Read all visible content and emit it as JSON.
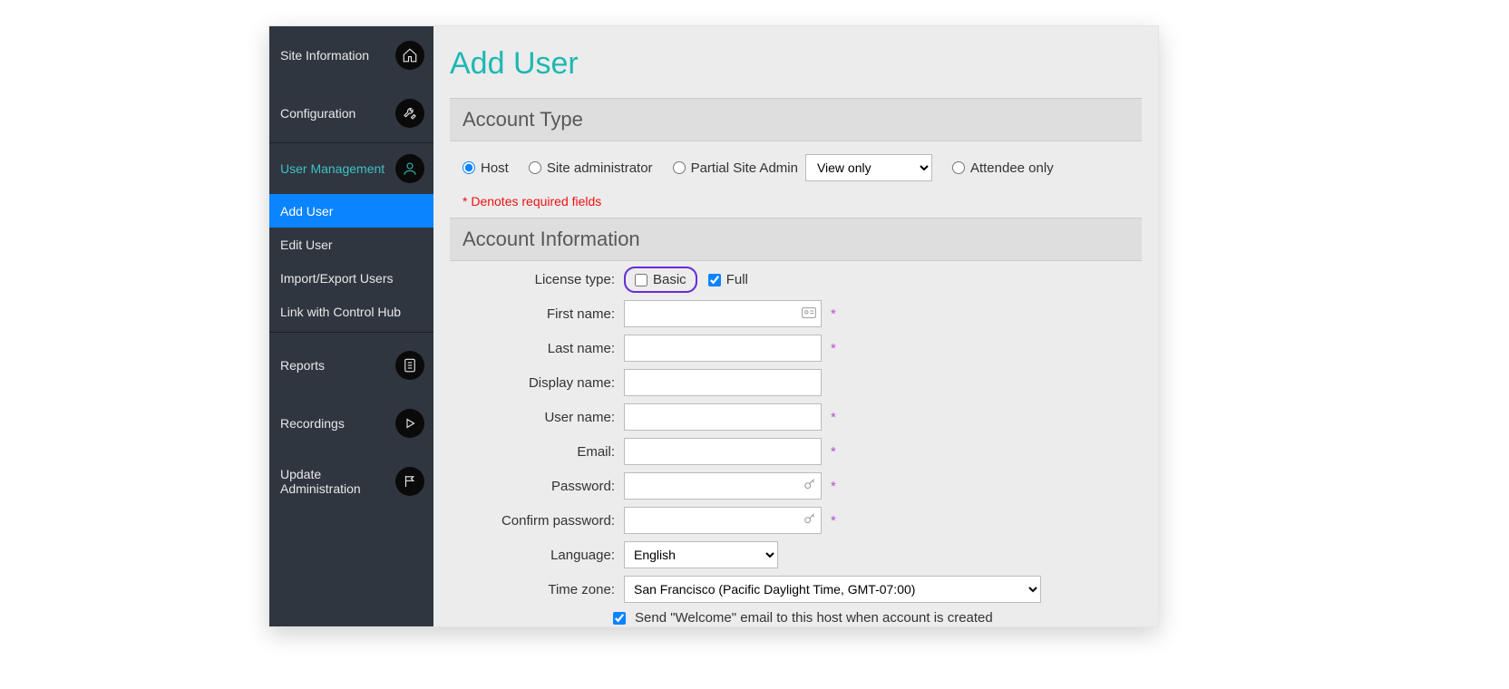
{
  "sidebar": {
    "site_information": "Site Information",
    "configuration": "Configuration",
    "user_management": "User Management",
    "submenu": {
      "add_user": "Add User",
      "edit_user": "Edit User",
      "import_export": "Import/Export Users",
      "link_hub": "Link with Control Hub"
    },
    "reports": "Reports",
    "recordings": "Recordings",
    "update_admin": "Update Administration"
  },
  "page": {
    "title": "Add User",
    "required_note": "* Denotes required fields"
  },
  "account_type": {
    "header": "Account Type",
    "host": "Host",
    "site_admin": "Site administrator",
    "partial_admin": "Partial Site Admin",
    "partial_select": "View only",
    "attendee_only": "Attendee only"
  },
  "account_info": {
    "header": "Account Information",
    "labels": {
      "license_type": "License type:",
      "first_name": "First name:",
      "last_name": "Last name:",
      "display_name": "Display name:",
      "user_name": "User name:",
      "email": "Email:",
      "password": "Password:",
      "confirm_password": "Confirm password:",
      "language": "Language:",
      "time_zone": "Time zone:"
    },
    "license": {
      "basic": "Basic",
      "full": "Full"
    },
    "language_value": "English",
    "timezone_value": "San Francisco (Pacific Daylight Time, GMT-07:00)",
    "welcome_text": "Send \"Welcome\" email to this host when account is created"
  }
}
